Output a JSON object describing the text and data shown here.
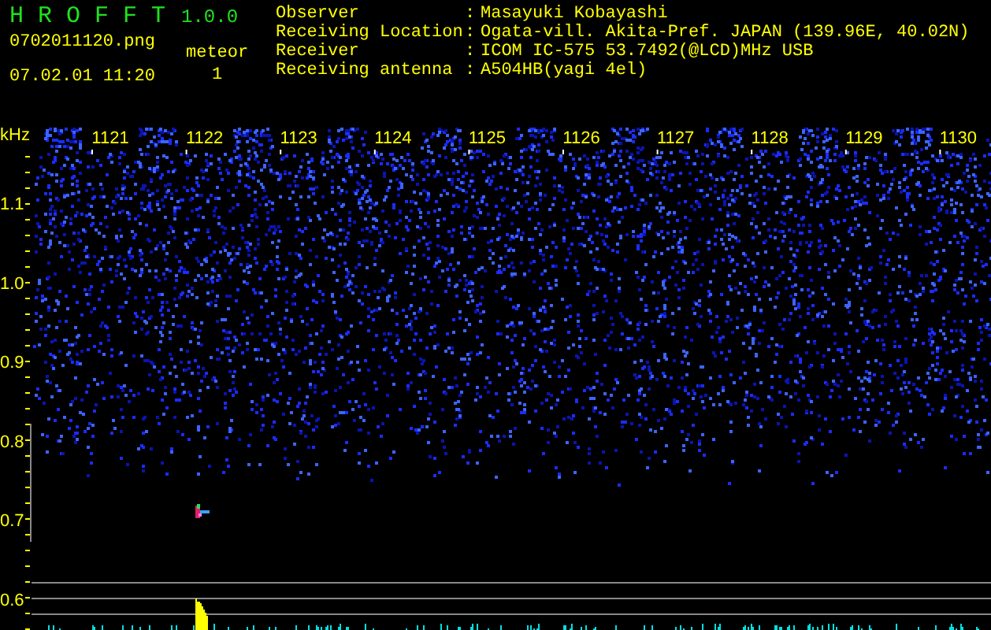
{
  "app": {
    "title": "H R O F F T",
    "version": "1.0.0"
  },
  "file": {
    "name": "0702011120.png",
    "datetime": "07.02.01 11:20"
  },
  "meteor": {
    "label": "meteor",
    "count": "1"
  },
  "info": [
    {
      "label": "Observer",
      "separator": ":",
      "value": "Masayuki Kobayashi"
    },
    {
      "label": "Receiving Location",
      "separator": ":",
      "value": "Ogata-vill. Akita-Pref. JAPAN (139.96E, 40.02N)"
    },
    {
      "label": "Receiver",
      "separator": ":",
      "value": "ICOM IC-575 53.7492(@LCD)MHz USB"
    },
    {
      "label": "Receiving antenna",
      "separator": ":",
      "value": "A504HB(yagi 4el)"
    }
  ],
  "spectrogram": {
    "unit": "kHz",
    "x_labels": [
      "1121",
      "1122",
      "1123",
      "1124",
      "1125",
      "1126",
      "1127",
      "1128",
      "1129",
      "1130"
    ],
    "y_labels": [
      "1.1",
      "1.0",
      "0.9",
      "0.8",
      "0.7",
      "0.6"
    ]
  }
}
